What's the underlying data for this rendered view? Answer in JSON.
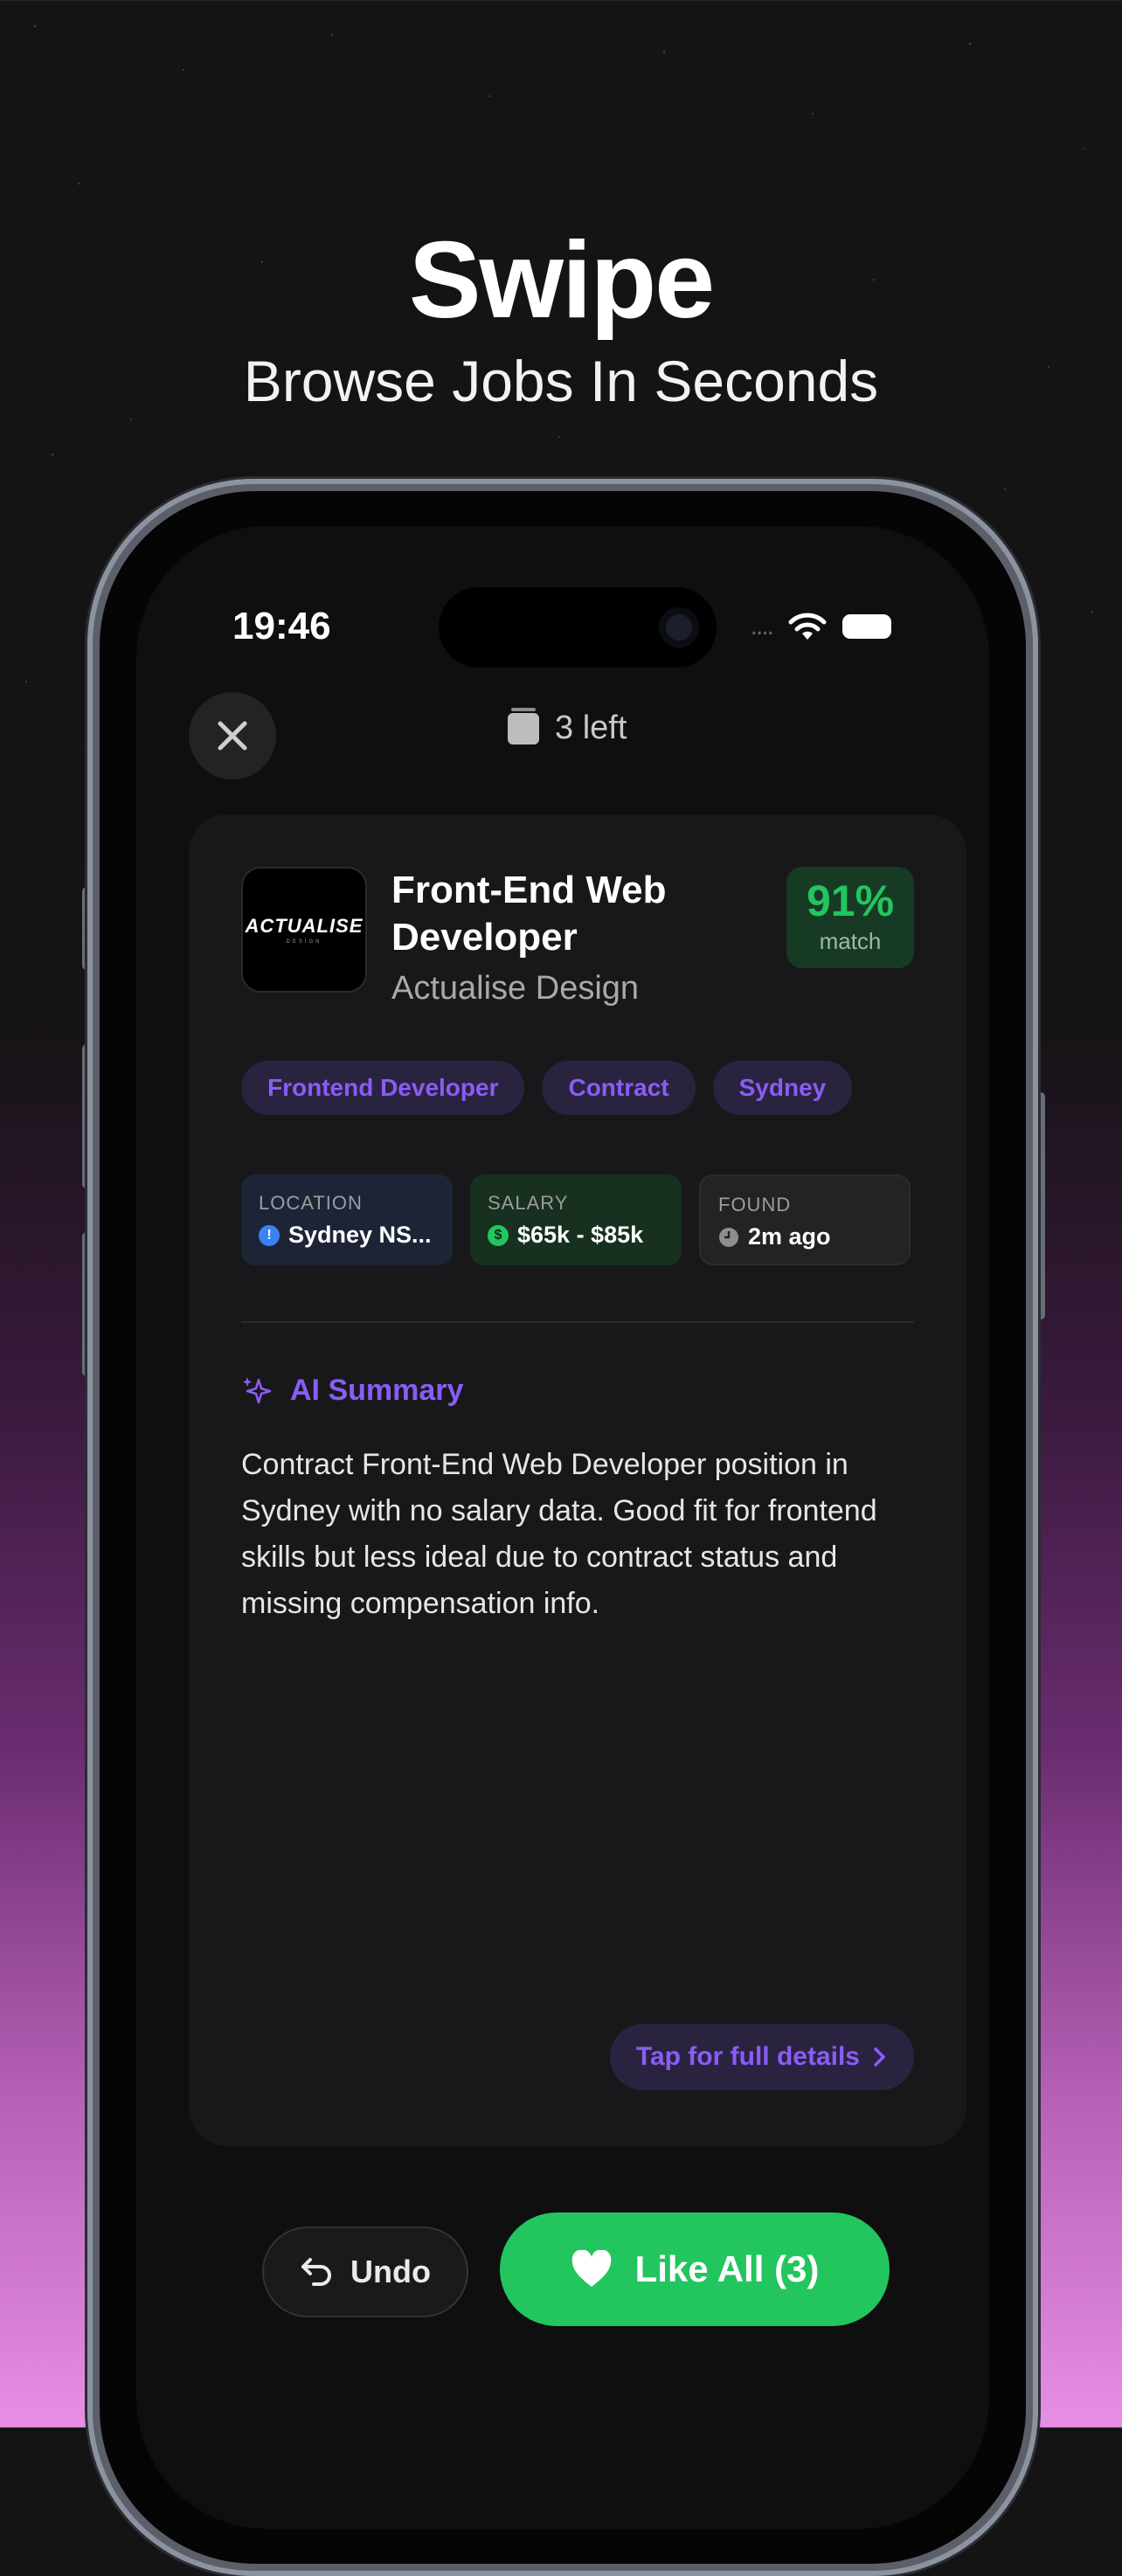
{
  "hero": {
    "title": "Swipe",
    "subtitle": "Browse Jobs In Seconds"
  },
  "status_bar": {
    "time": "19:46",
    "dots": "....",
    "icons": [
      "wifi-icon",
      "battery-icon"
    ]
  },
  "top_bar": {
    "close_icon": "close-icon",
    "remaining_label": "3 left",
    "stack_icon": "stack-icon"
  },
  "job": {
    "logo_text": "ACTUALISE",
    "logo_subtext": "DESIGN",
    "title": "Front-End Web Developer",
    "company": "Actualise Design",
    "match": {
      "value": "91%",
      "label": "match",
      "color": "#22c55e"
    },
    "tags": [
      "Frontend Developer",
      "Contract",
      "Sydney"
    ],
    "info": [
      {
        "label": "LOCATION",
        "value": "Sydney NS...",
        "icon": "location-icon"
      },
      {
        "label": "SALARY",
        "value": "$65k - $85k",
        "icon": "dollar-icon"
      },
      {
        "label": "FOUND",
        "value": "2m ago",
        "icon": "clock-icon"
      }
    ],
    "ai_summary": {
      "heading": "AI Summary",
      "icon": "sparkle-icon",
      "text": "Contract Front-End Web Developer position in Sydney with no salary data. Good fit for frontend skills but less ideal due to contract status and missing compensation info."
    },
    "details_button": "Tap for full details"
  },
  "actions": {
    "undo_label": "Undo",
    "like_label": "Like All (3)"
  },
  "colors": {
    "accent_purple": "#8b5cf6",
    "accent_green": "#22c55e"
  }
}
